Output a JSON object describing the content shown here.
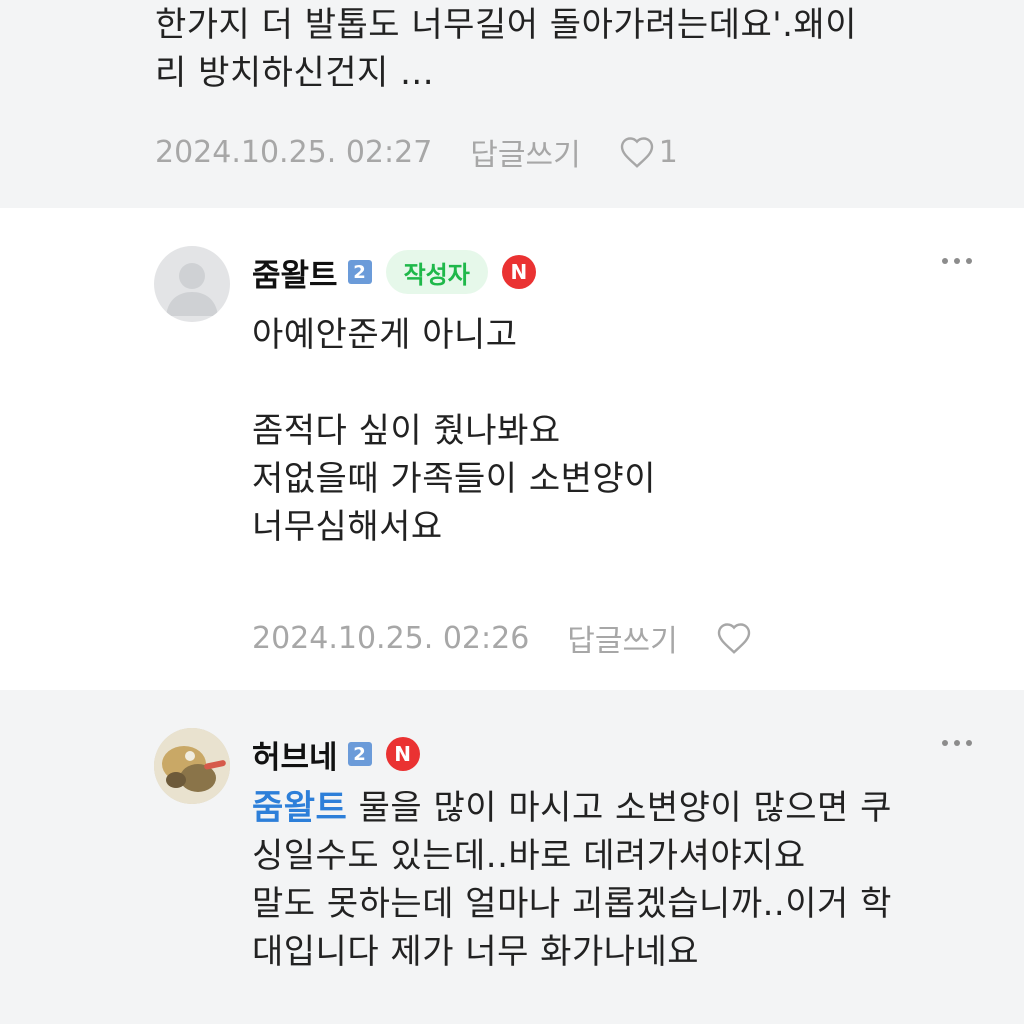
{
  "comments": [
    {
      "text": "한가지 더 발톱도 너무길어 돌아가려는데요'.왜이\n리 방치하신건지 ...",
      "date": "2024.10.25. 02:27",
      "reply_label": "답글쓰기",
      "like_count": "1"
    },
    {
      "nickname": "줌왈트",
      "level": "2",
      "author_badge": "작성자",
      "new_badge": "N",
      "text": "아예안준게 아니고\n\n좀적다 싶이 줬나봐요\n저없을때 가족들이 소변양이\n너무심해서요",
      "date": "2024.10.25. 02:26",
      "reply_label": "답글쓰기"
    },
    {
      "nickname": "허브네",
      "level": "2",
      "new_badge": "N",
      "mention": "줌왈트",
      "text": " 물을 많이 마시고 소변양이 많으면 쿠\n싱일수도 있는데..바로 데려가셔야지요\n말도 못하는데 얼마나 괴롭겠습니까..이거 학\n대입니다 제가 너무 화가나네요"
    }
  ],
  "colors": {
    "accent_green": "#1fb84a",
    "mention_blue": "#2d7fd9",
    "new_red": "#ea3232",
    "level_blue": "#6b9bd9"
  },
  "icons": [
    "heart-icon",
    "more-icon",
    "default-avatar-icon",
    "new-badge-icon",
    "level-badge-icon"
  ]
}
